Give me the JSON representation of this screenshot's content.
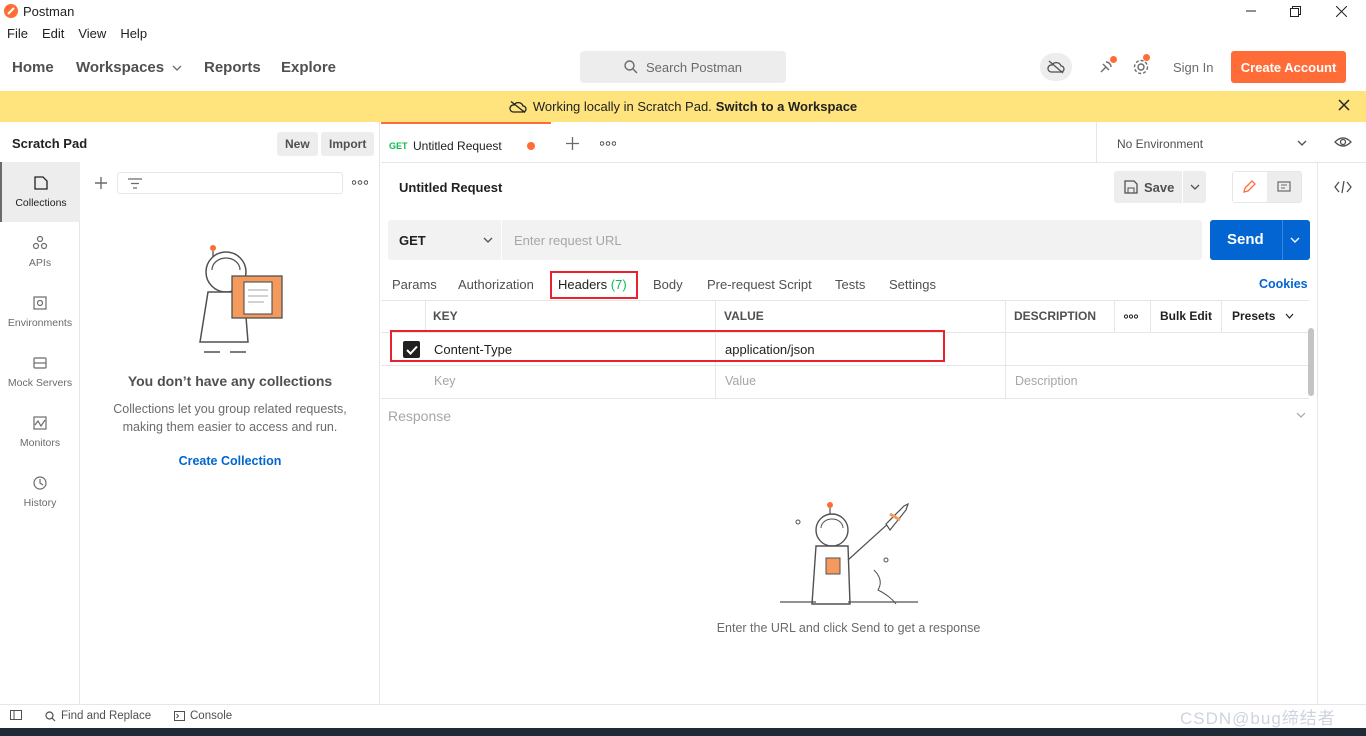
{
  "app": {
    "title": "Postman"
  },
  "menu": [
    "File",
    "Edit",
    "View",
    "Help"
  ],
  "header": {
    "nav": {
      "home": "Home",
      "workspaces": "Workspaces",
      "reports": "Reports",
      "explore": "Explore"
    },
    "search_placeholder": "Search Postman",
    "sign_in": "Sign In",
    "create_account": "Create Account"
  },
  "banner": {
    "text": "Working locally in Scratch Pad.",
    "link": "Switch to a Workspace"
  },
  "sidebar": {
    "title": "Scratch Pad",
    "new_label": "New",
    "import_label": "Import",
    "rail": [
      "Collections",
      "APIs",
      "Environments",
      "Mock Servers",
      "Monitors",
      "History"
    ],
    "empty_title": "You don’t have any collections",
    "empty_desc": "Collections let you group related requests, making them easier to access and run.",
    "create_collection": "Create Collection"
  },
  "tab": {
    "method": "GET",
    "name": "Untitled Request"
  },
  "environment": "No Environment",
  "request": {
    "title": "Untitled Request",
    "save_label": "Save",
    "method": "GET",
    "url_placeholder": "Enter request URL",
    "send_label": "Send",
    "tabs": {
      "params": "Params",
      "authorization": "Authorization",
      "headers": "Headers",
      "headers_count": "(7)",
      "body": "Body",
      "prerequest": "Pre-request Script",
      "tests": "Tests",
      "settings": "Settings"
    },
    "cookies": "Cookies"
  },
  "headers_table": {
    "columns": {
      "key": "KEY",
      "value": "VALUE",
      "description": "DESCRIPTION",
      "bulk_edit": "Bulk Edit",
      "presets": "Presets"
    },
    "rows": [
      {
        "checked": true,
        "key": "Content-Type",
        "value": "application/json",
        "description": ""
      }
    ],
    "placeholders": {
      "key": "Key",
      "value": "Value",
      "description": "Description"
    }
  },
  "response": {
    "label": "Response",
    "hint": "Enter the URL and click Send to get a response"
  },
  "footer": {
    "find_replace": "Find and Replace",
    "console": "Console"
  },
  "watermark": "CSDN@bug缔结者",
  "colors": {
    "accent": "#ff6c37",
    "primary": "#0265d2",
    "banner": "#ffe47e",
    "highlight": "#e8232e",
    "get": "#0cbb52"
  }
}
